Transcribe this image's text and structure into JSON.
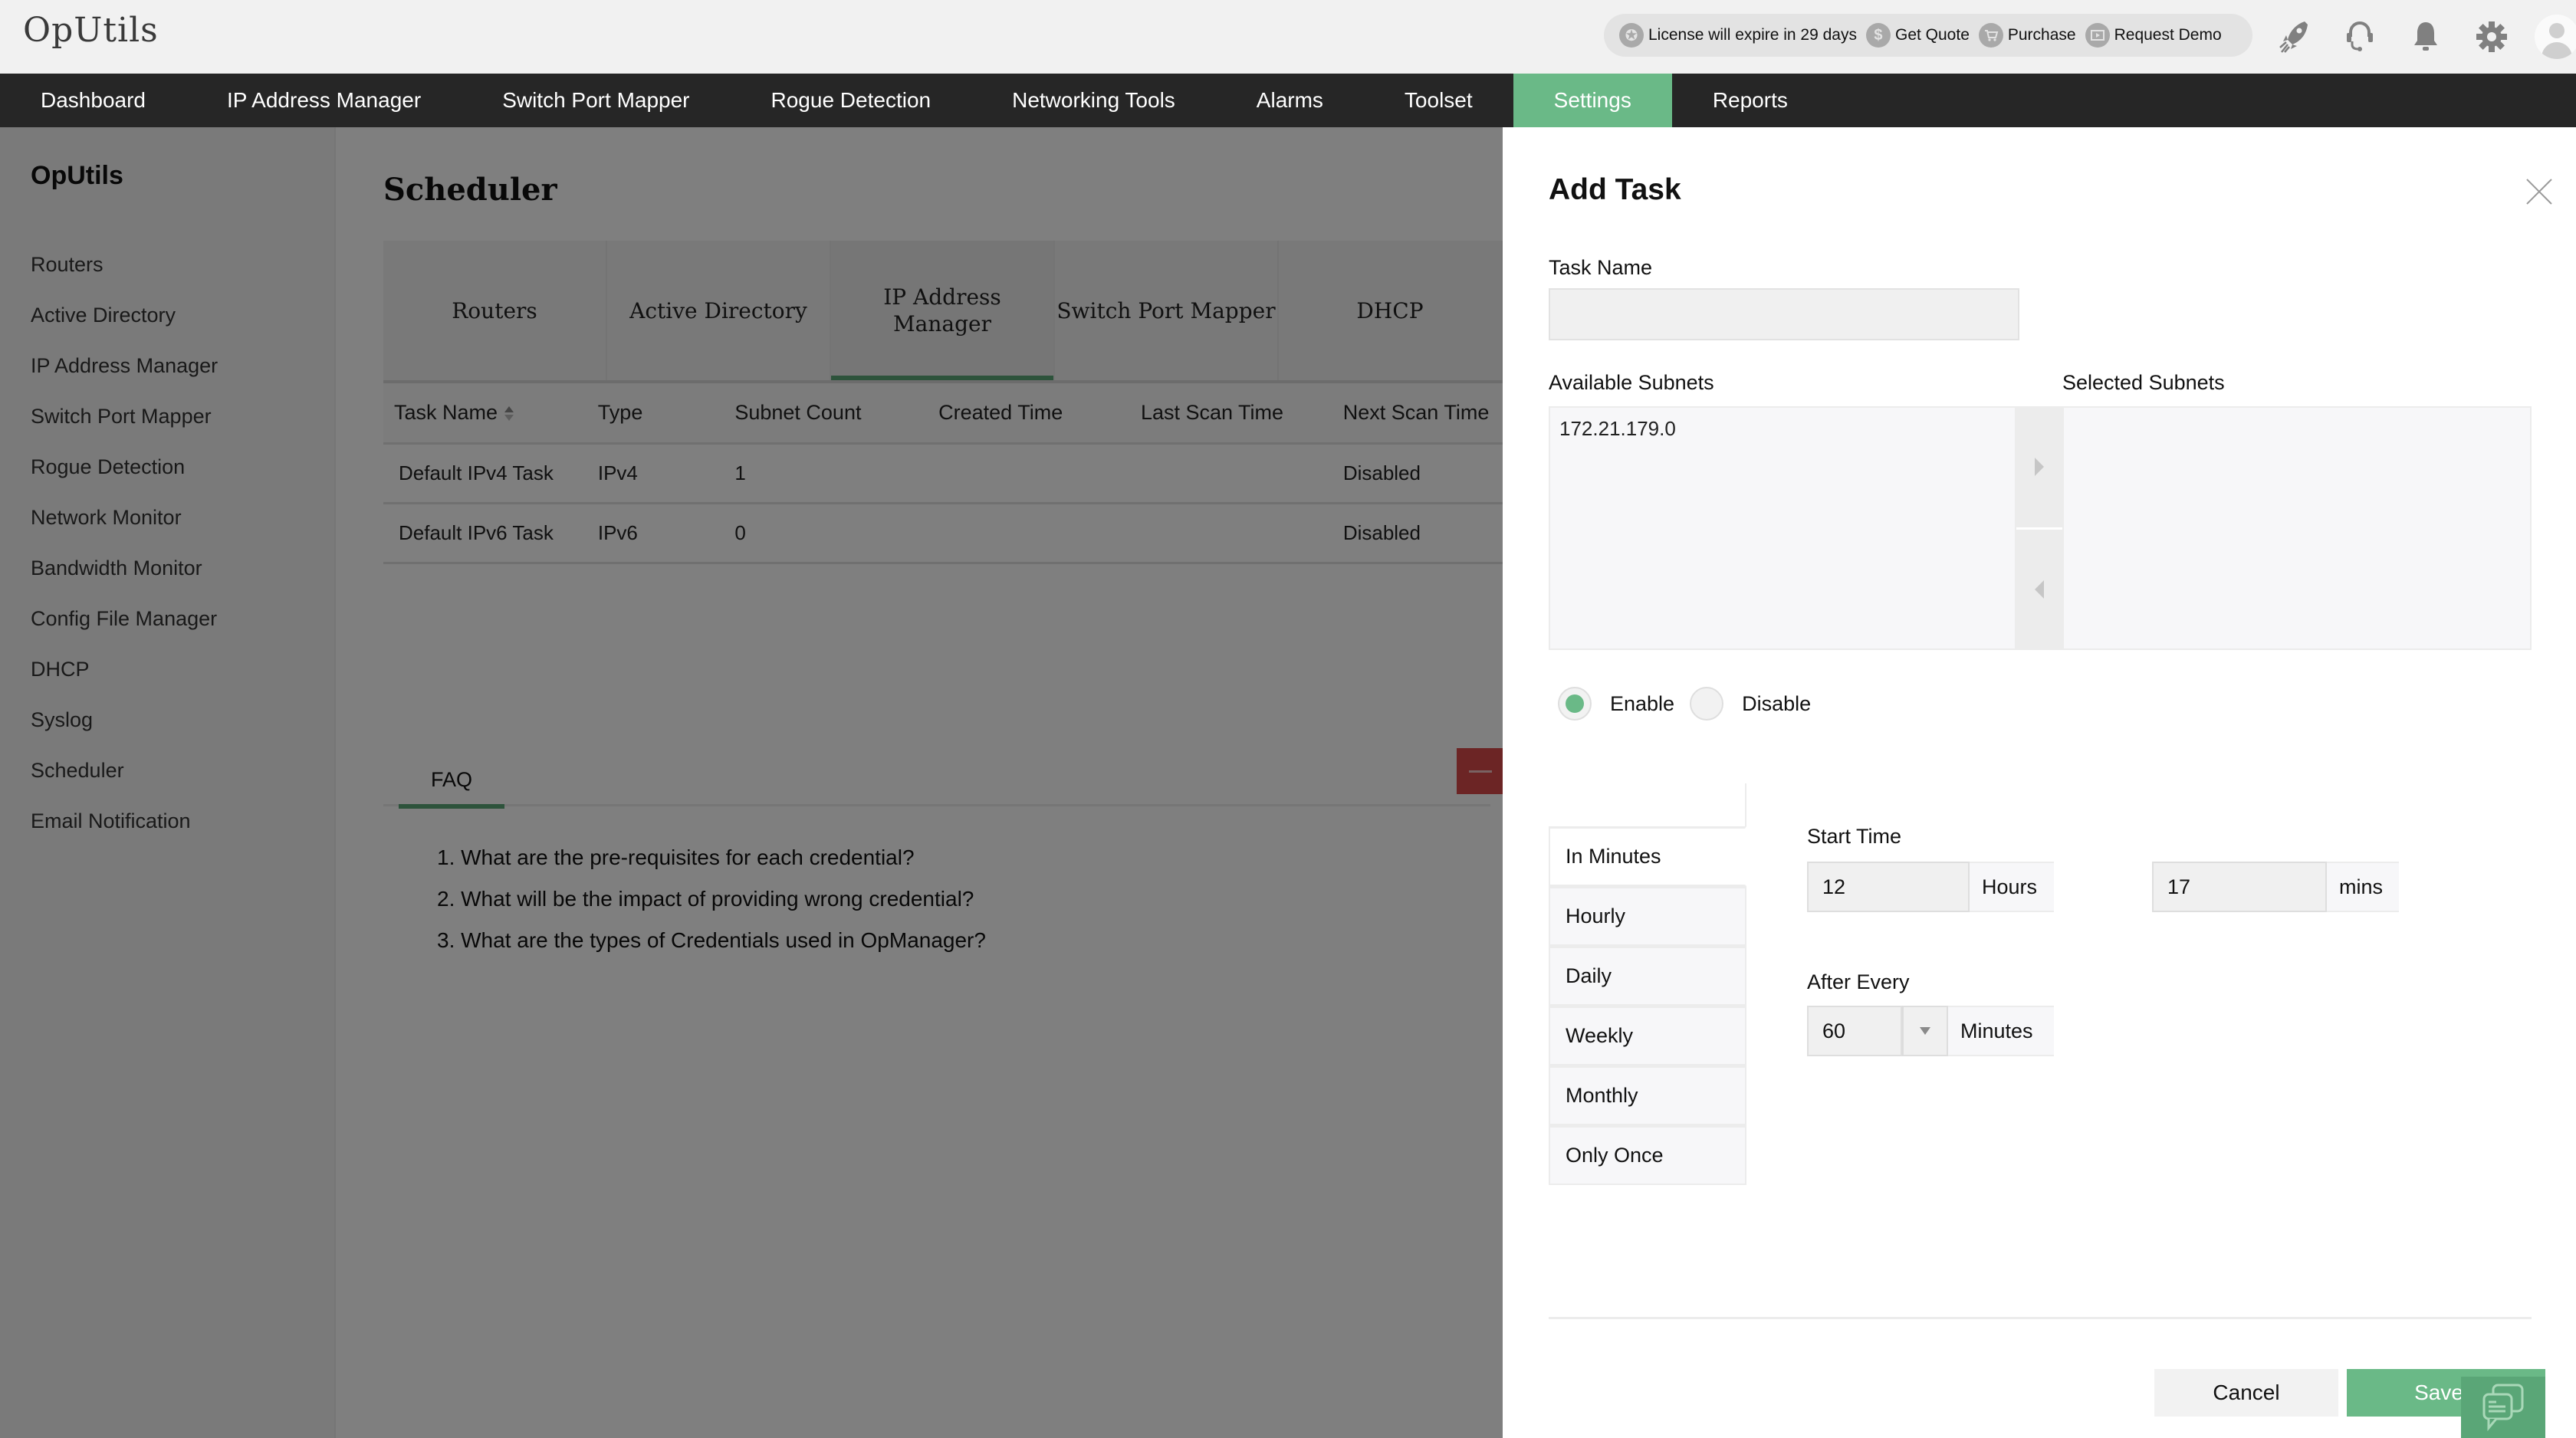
{
  "app": {
    "logo": "OpUtils"
  },
  "promo": {
    "license": "License will expire in 29 days",
    "get_quote": "Get Quote",
    "purchase": "Purchase",
    "request_demo": "Request Demo"
  },
  "header_icons": [
    "rocket-icon",
    "support-headset-icon",
    "bell-icon",
    "gear-icon",
    "avatar"
  ],
  "nav": {
    "items": [
      "Dashboard",
      "IP Address Manager",
      "Switch Port Mapper",
      "Rogue Detection",
      "Networking Tools",
      "Alarms",
      "Toolset",
      "Settings",
      "Reports"
    ],
    "active": "Settings"
  },
  "sidebar": {
    "title": "OpUtils",
    "items": [
      "Routers",
      "Active Directory",
      "IP Address Manager",
      "Switch Port Mapper",
      "Rogue Detection",
      "Network Monitor",
      "Bandwidth Monitor",
      "Config File Manager",
      "DHCP",
      "Syslog",
      "Scheduler",
      "Email Notification"
    ]
  },
  "main": {
    "title": "Scheduler",
    "module_tabs": [
      "Routers",
      "Active Directory",
      "IP Address Manager",
      "Switch Port Mapper",
      "DHCP"
    ],
    "active_module_tab": "IP Address Manager",
    "table": {
      "columns": [
        "Task Name",
        "Type",
        "Subnet Count",
        "Created Time",
        "Last Scan Time",
        "Next Scan Time"
      ],
      "rows": [
        [
          "Default IPv4 Task",
          "IPv4",
          "1",
          "",
          "",
          "Disabled"
        ],
        [
          "Default IPv6 Task",
          "IPv6",
          "0",
          "",
          "",
          "Disabled"
        ]
      ]
    },
    "faq": {
      "tab": "FAQ",
      "items": [
        "1. What are the pre-requisites for each credential?",
        "2. What will be the impact of providing wrong credential?",
        "3. What are the types of Credentials used in OpManager?"
      ]
    }
  },
  "panel": {
    "title": "Add Task",
    "task_name_label": "Task Name",
    "task_name_value": "",
    "available_label": "Available Subnets",
    "selected_label": "Selected Subnets",
    "available_subnets": [
      "172.21.179.0"
    ],
    "selected_subnets": [],
    "status": {
      "enable": "Enable",
      "disable": "Disable",
      "selected": "Enable"
    },
    "frequency_tabs": [
      "In Minutes",
      "Hourly",
      "Daily",
      "Weekly",
      "Monthly",
      "Only Once"
    ],
    "active_frequency": "In Minutes",
    "start_time_label": "Start Time",
    "start_hours": "12",
    "hours_suffix": "Hours",
    "start_mins": "17",
    "mins_suffix": "mins",
    "after_every_label": "After Every",
    "after_every_value": "60",
    "after_every_suffix": "Minutes",
    "cancel": "Cancel",
    "save": "Save"
  },
  "colors": {
    "accent_green": "#6ab987",
    "nav_bg": "#262626",
    "faq_minimize": "#d94b4b"
  }
}
